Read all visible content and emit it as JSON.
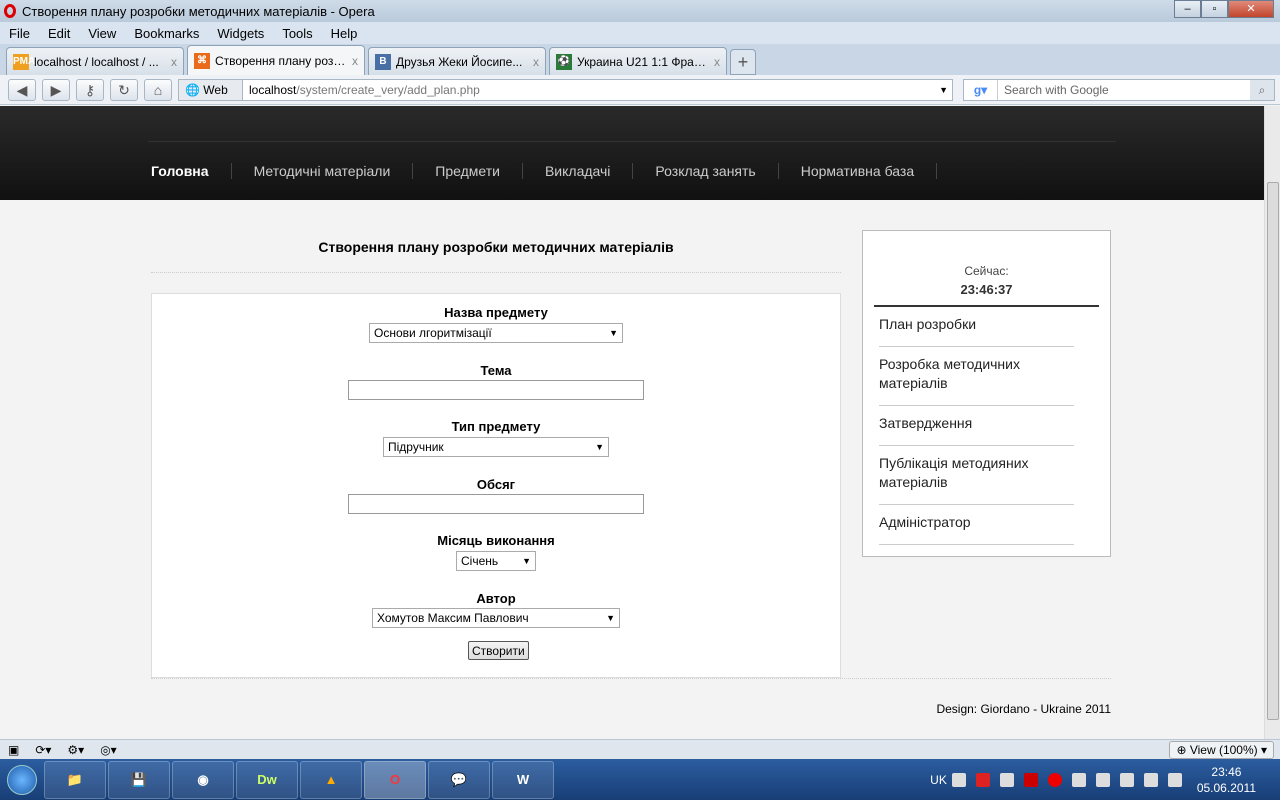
{
  "window": {
    "title": "Створення плану розробки методичних матеріалів - Opera"
  },
  "menu": [
    "File",
    "Edit",
    "View",
    "Bookmarks",
    "Widgets",
    "Tools",
    "Help"
  ],
  "tabs": [
    {
      "label": "localhost / localhost / ...",
      "icon": "PMA",
      "color": "#f0a020"
    },
    {
      "label": "Створення плану розр...",
      "icon": "⌘",
      "color": "#e86a1a"
    },
    {
      "label": "Друзья Жеки Йосипе...",
      "icon": "B",
      "color": "#4a6fa5"
    },
    {
      "label": "Украина U21 1:1 Фран...",
      "icon": "⚽",
      "color": "#2a7a3a"
    }
  ],
  "address": {
    "mode": "Web",
    "host": "localhost",
    "path": "/system/create_very/add_plan.php"
  },
  "search": {
    "placeholder": "Search with Google"
  },
  "site_nav": [
    "Головна",
    "Методичні матеріали",
    "Предмети",
    "Викладачі",
    "Розклад занять",
    "Нормативна база"
  ],
  "form": {
    "title": "Створення плану розробки методичних матеріалів",
    "subject_label": "Назва предмету",
    "subject_value": "Основи лгоритмізації",
    "topic_label": "Тема",
    "topic_value": "",
    "type_label": "Тип предмету",
    "type_value": "Підручник",
    "volume_label": "Обсяг",
    "volume_value": "",
    "month_label": "Місяць виконання",
    "month_value": "Січень",
    "author_label": "Автор",
    "author_value": "Хомутов Максим Павлович",
    "submit": "Створити"
  },
  "sidebar": {
    "now_label": "Сейчас:",
    "time": "23:46:37",
    "items": [
      "План розробки",
      "Розробка методичних матеріалів",
      "Затвердження",
      "Публікація методияних матеріалів",
      "Адміністратор"
    ]
  },
  "footer": "Design: Giordano - Ukraine 2011",
  "statusbar": {
    "zoom": "View (100%)"
  },
  "taskbar": {
    "apps": [
      "📁",
      "💾",
      "◉",
      "Dw",
      "▲",
      "O",
      "💬",
      "W"
    ],
    "lang": "UK",
    "time": "23:46",
    "date": "05.06.2011"
  }
}
